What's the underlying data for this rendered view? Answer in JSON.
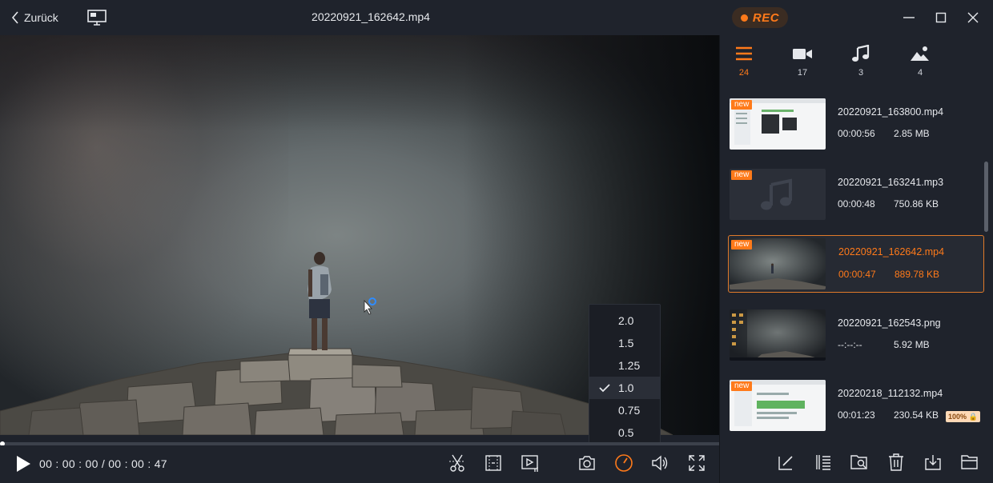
{
  "titlebar": {
    "back_label": "Zurück",
    "file_title": "20220921_162642.mp4",
    "rec_label": "REC",
    "accent": "#ff7a1a"
  },
  "player": {
    "timecode": "00 : 00 : 00 / 00 : 00 : 47",
    "progress": 0.0
  },
  "speed_menu": {
    "options": [
      "2.0",
      "1.5",
      "1.25",
      "1.0",
      "0.75",
      "0.5"
    ],
    "selected": "1.0"
  },
  "controls": {
    "icons": [
      "play-icon",
      "cut-icon",
      "crop-icon",
      "play-list-icon",
      "camera-icon",
      "speed-icon",
      "volume-icon",
      "fullscreen-icon"
    ]
  },
  "filter_tabs": [
    {
      "icon": "all-list-icon",
      "count": "24"
    },
    {
      "icon": "video-icon",
      "count": "17"
    },
    {
      "icon": "music-icon",
      "count": "3"
    },
    {
      "icon": "image-icon",
      "count": "4"
    }
  ],
  "files": [
    {
      "name": "20220921_163800.mp4",
      "duration": "00:00:56",
      "size": "2.85 MB",
      "badge": "new",
      "thumb": "screen"
    },
    {
      "name": "20220921_163241.mp3",
      "duration": "00:00:48",
      "size": "750.86 KB",
      "badge": "new",
      "thumb": "audio"
    },
    {
      "name": "20220921_162642.mp4",
      "duration": "00:00:47",
      "size": "889.78 KB",
      "badge": "new",
      "thumb": "scene"
    },
    {
      "name": "20220921_162543.png",
      "duration": "--:--:--",
      "size": "5.92 MB",
      "badge": "",
      "thumb": "desktop"
    },
    {
      "name": "20220218_112132.mp4",
      "duration": "00:01:23",
      "size": "230.54 KB",
      "badge": "new",
      "thumb": "screen2",
      "extra_badge": "100%"
    }
  ],
  "bottom_tools": [
    "edit-icon",
    "sort-icon",
    "folder-search-icon",
    "delete-icon",
    "export-icon",
    "open-folder-icon"
  ]
}
